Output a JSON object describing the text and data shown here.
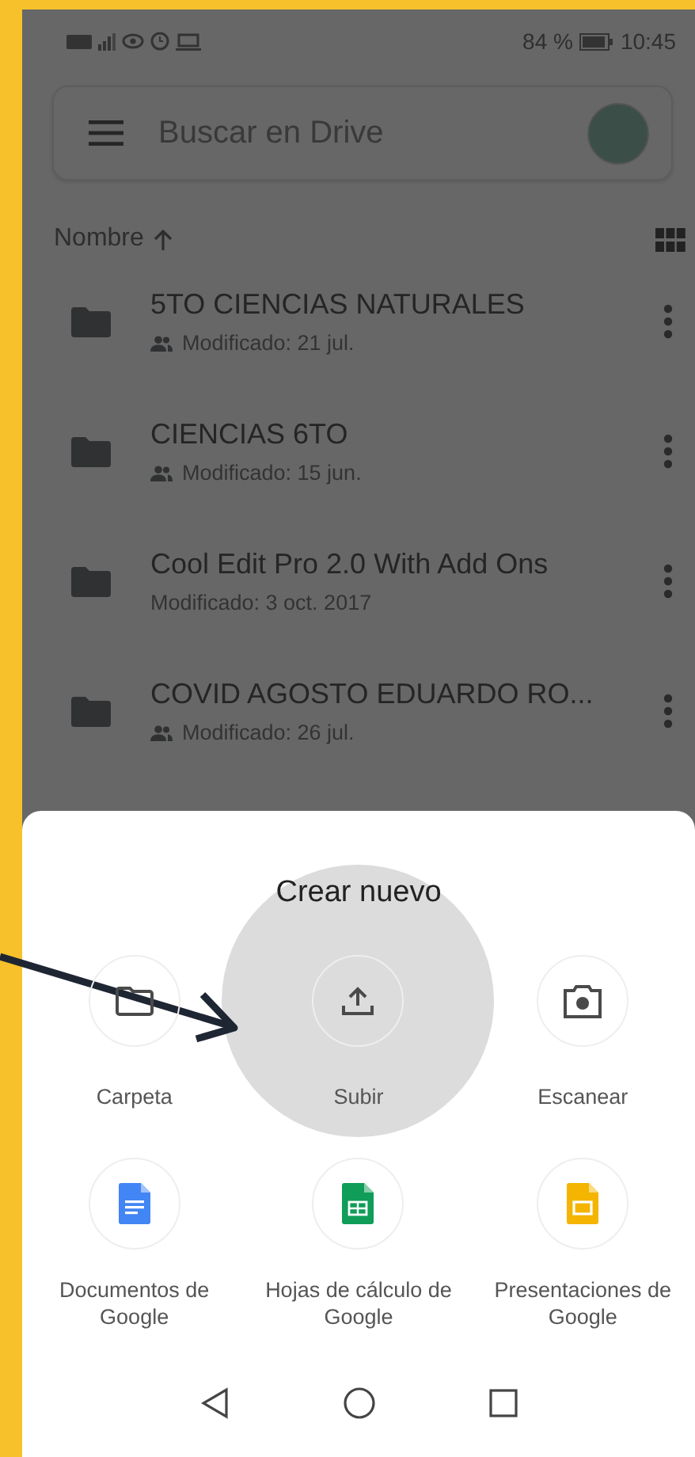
{
  "status_bar": {
    "battery": "84 %",
    "time": "10:45"
  },
  "search": {
    "placeholder": "Buscar en Drive"
  },
  "sort": {
    "label": "Nombre"
  },
  "files": [
    {
      "name": "5TO CIENCIAS NATURALES",
      "modified": "Modificado: 21 jul.",
      "shared": true
    },
    {
      "name": "CIENCIAS 6TO",
      "modified": "Modificado: 15 jun.",
      "shared": true
    },
    {
      "name": "Cool Edit Pro 2.0 With Add Ons",
      "modified": "Modificado: 3 oct. 2017",
      "shared": false
    },
    {
      "name": "COVID AGOSTO EDUARDO RO...",
      "modified": "Modificado: 26 jul.",
      "shared": true
    }
  ],
  "sheet": {
    "title": "Crear nuevo",
    "actions": [
      {
        "kind": "folder",
        "label": "Carpeta",
        "pressed": false
      },
      {
        "kind": "upload",
        "label": "Subir",
        "pressed": true
      },
      {
        "kind": "scan",
        "label": "Escanear",
        "pressed": false
      },
      {
        "kind": "docs",
        "label": "Documentos de Google",
        "pressed": false
      },
      {
        "kind": "sheets",
        "label": "Hojas de cálculo de Google",
        "pressed": false
      },
      {
        "kind": "slides",
        "label": "Presentaciones de Google",
        "pressed": false
      }
    ]
  }
}
